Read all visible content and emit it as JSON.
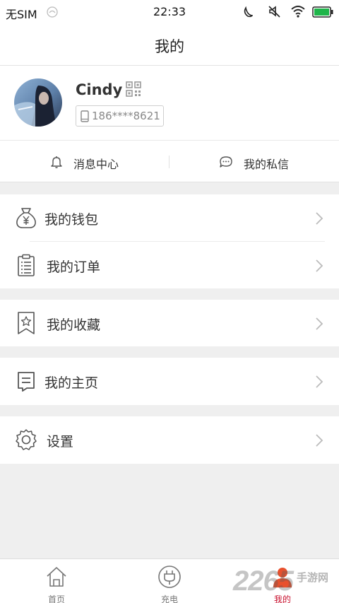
{
  "status_bar": {
    "carrier": "无SIM",
    "time": "22:33",
    "battery_color": "#1fb54a"
  },
  "header": {
    "title": "我的"
  },
  "profile": {
    "name": "Cindy",
    "phone": "186****8621"
  },
  "messages": {
    "center_label": "消息中心",
    "private_label": "我的私信"
  },
  "menu": {
    "wallet": "我的钱包",
    "orders": "我的订单",
    "favorites": "我的收藏",
    "homepage": "我的主页",
    "settings": "设置"
  },
  "tabs": [
    {
      "label": "首页",
      "icon": "home-icon"
    },
    {
      "label": "充电",
      "icon": "charge-plug-icon"
    },
    {
      "label": "我的",
      "icon": "person-icon"
    }
  ],
  "colors": {
    "accent": "#c8102e",
    "icon_gray": "#555555"
  },
  "watermark": {
    "text": "2265",
    "sub": "手游网"
  }
}
